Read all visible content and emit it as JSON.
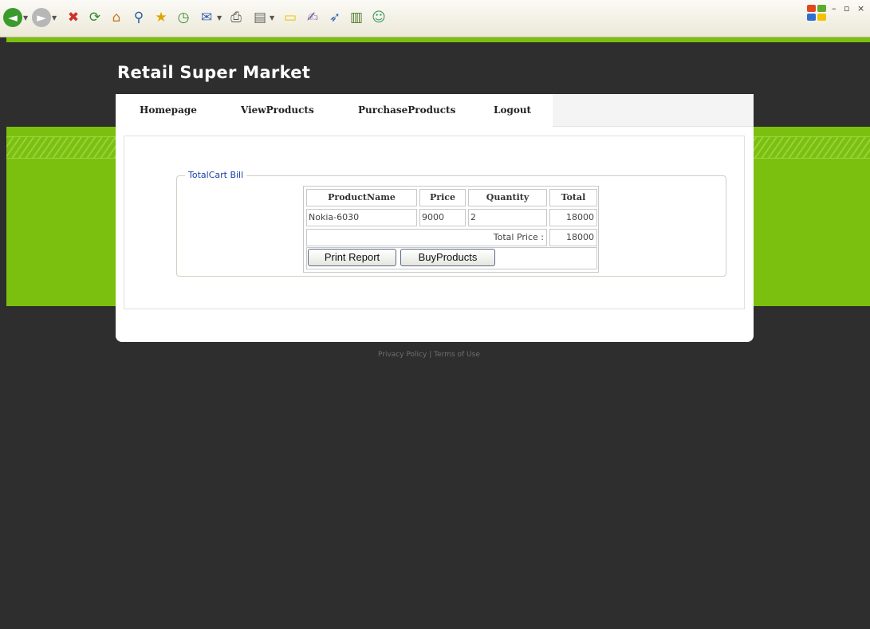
{
  "browser": {
    "icons": [
      "back-icon",
      "forward-icon",
      "stop-icon",
      "refresh-icon",
      "home-icon",
      "search-icon",
      "favorites-icon",
      "history-icon",
      "mail-icon",
      "print-icon",
      "edit-icon",
      "note-icon",
      "messenger-icon",
      "research-icon",
      "stats-icon",
      "users-icon"
    ],
    "window_controls": "– ▫ ×"
  },
  "site": {
    "title": "Retail Super Market"
  },
  "nav": {
    "items": [
      "Homepage",
      "ViewProducts",
      "PurchaseProducts",
      "Logout"
    ]
  },
  "bill": {
    "legend": "TotalCart Bill",
    "headers": [
      "ProductName",
      "Price",
      "Quantity",
      "Total"
    ],
    "rows": [
      {
        "product": "Nokia-6030",
        "price": "9000",
        "quantity": "2",
        "total": "18000"
      }
    ],
    "total_label": "Total Price :",
    "total_value": "18000",
    "print_label": "Print Report",
    "buy_label": "BuyProducts"
  },
  "footer": {
    "privacy": "Privacy Policy",
    "separator": "|",
    "terms": "Terms of Use"
  },
  "colors": {
    "green": "#7cc00f",
    "dark": "#2e2e2e",
    "legend_blue": "#1a3fa8"
  }
}
